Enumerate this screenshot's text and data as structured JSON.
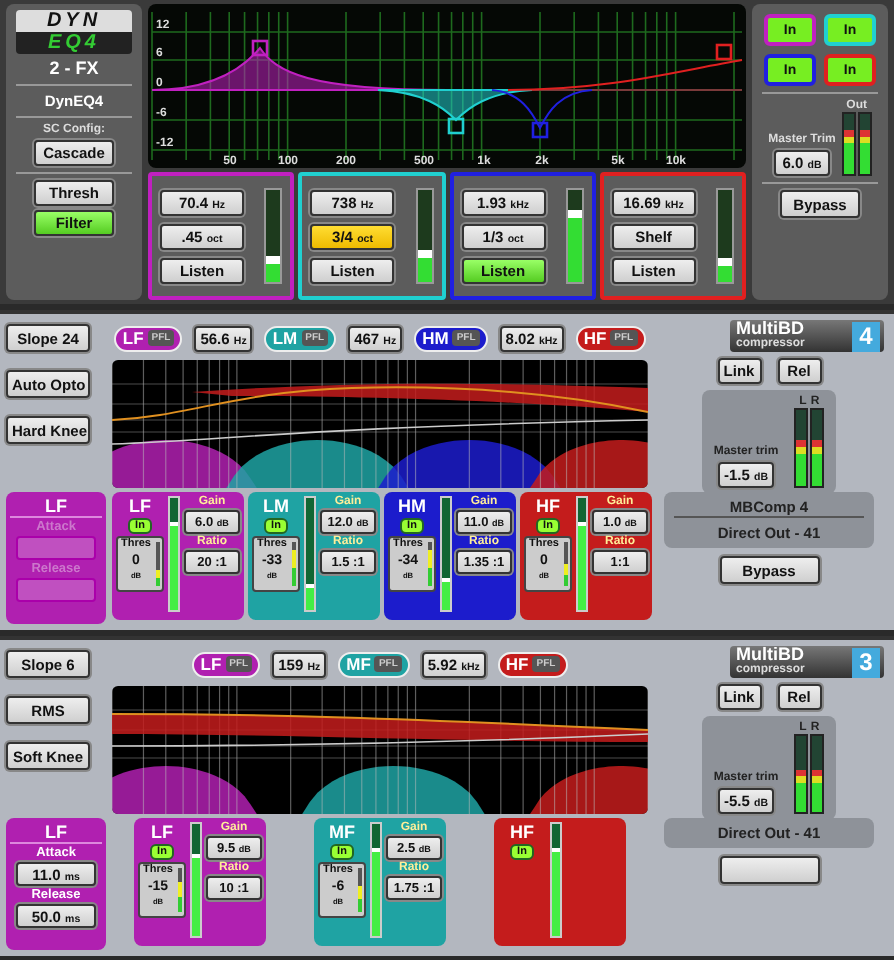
{
  "eq": {
    "logo": {
      "top": "DYN",
      "bottom": "EQ4"
    },
    "channel": "2 - FX",
    "name": "DynEQ4",
    "sc_label": "SC Config:",
    "sc_mode": "Cascade",
    "sc_buttons": [
      {
        "label": "Thresh",
        "on": false
      },
      {
        "label": "Filter",
        "on": true
      }
    ],
    "graph": {
      "y_labels": [
        "12",
        "6",
        "0",
        "-6",
        "-12"
      ],
      "x_labels": [
        "50",
        "100",
        "200",
        "500",
        "1k",
        "2k",
        "5k",
        "10k"
      ]
    },
    "bands": [
      {
        "color": "#c020c0",
        "freq": "70.4",
        "freq_unit": "Hz",
        "width": ".45",
        "width_unit": "oct",
        "width_active": false,
        "listen": "Listen",
        "listen_on": false,
        "level": 0.25
      },
      {
        "color": "#20d0d0",
        "freq": "738",
        "freq_unit": "Hz",
        "width": "3/4",
        "width_unit": "oct",
        "width_active": true,
        "listen": "Listen",
        "listen_on": false,
        "level": 0.3
      },
      {
        "color": "#2020e0",
        "freq": "1.93",
        "freq_unit": "kHz",
        "width": "1/3",
        "width_unit": "oct",
        "width_active": false,
        "listen": "Listen",
        "listen_on": true,
        "level": 0.75
      },
      {
        "color": "#e02020",
        "freq": "16.69",
        "freq_unit": "kHz",
        "width": "Shelf",
        "width_active": false,
        "listen": "Listen",
        "listen_on": false,
        "level": 0.22
      }
    ],
    "in_buttons": [
      {
        "label": "In",
        "on": true
      },
      {
        "label": "In",
        "on": true
      },
      {
        "label": "In",
        "on": true
      },
      {
        "label": "In",
        "on": true
      }
    ],
    "master_trim": {
      "label": "Master Trim",
      "value": "6.0",
      "unit": "dB"
    },
    "out": {
      "label": "Out",
      "meters": [
        {
          "level": 0.75
        },
        {
          "level": 0.75
        }
      ]
    },
    "bypass": {
      "label": "Bypass",
      "on": false
    }
  },
  "compressors": [
    {
      "left_buttons": [
        "Slope 24",
        "Auto Opto",
        "Hard Knee"
      ],
      "band_panel": {
        "title": "LF",
        "color": "#b020b0",
        "disabled": true,
        "params": [
          {
            "label": "Attack"
          },
          {
            "label": "Release"
          }
        ]
      },
      "tags": [
        {
          "kind": "band",
          "label": "LF",
          "pfl": "PFL",
          "color": "#b020b0"
        },
        {
          "kind": "freq",
          "value": "56.6",
          "unit": "Hz"
        },
        {
          "kind": "band",
          "label": "LM",
          "pfl": "PFL",
          "color": "#1fa3a3"
        },
        {
          "kind": "freq",
          "value": "467",
          "unit": "Hz"
        },
        {
          "kind": "band",
          "label": "HM",
          "pfl": "PFL",
          "color": "#1c1ccc"
        },
        {
          "kind": "freq",
          "value": "8.02",
          "unit": "kHz"
        },
        {
          "kind": "band",
          "label": "HF",
          "pfl": "PFL",
          "color": "#c41c1c"
        }
      ],
      "logo": {
        "name": "MultiBD",
        "sub": "compressor",
        "number": "4"
      },
      "link": "Link",
      "rel": "Rel",
      "master_trim": {
        "label": "Master trim",
        "value": "-1.5",
        "unit": "dB"
      },
      "meter": {
        "left": "L",
        "right": "R",
        "meters": [
          {
            "level": 0.6
          },
          {
            "level": 0.6
          }
        ]
      },
      "bands": [
        {
          "name": "LF",
          "color": "#b020b0",
          "in": "In",
          "in_on": true,
          "level": 0.75,
          "thres": {
            "label": "Thres",
            "value": "0",
            "unit": "dB",
            "level": 0.35
          },
          "gain": {
            "label": "Gain",
            "value": "6.0",
            "unit": "dB"
          },
          "ratio": {
            "label": "Ratio",
            "value": "20 :1"
          }
        },
        {
          "name": "LM",
          "color": "#1fa3a3",
          "in": "In",
          "in_on": true,
          "level": 0.2,
          "thres": {
            "label": "Thres",
            "value": "-33",
            "unit": "dB",
            "level": 0.8
          },
          "gain": {
            "label": "Gain",
            "value": "12.0",
            "unit": "dB"
          },
          "ratio": {
            "label": "Ratio",
            "value": "1.5 :1"
          }
        },
        {
          "name": "HM",
          "color": "#1c1ccc",
          "in": "In",
          "in_on": true,
          "level": 0.25,
          "thres": {
            "label": "Thres",
            "value": "-34",
            "unit": "dB",
            "level": 0.8
          },
          "gain": {
            "label": "Gain",
            "value": "11.0",
            "unit": "dB"
          },
          "ratio": {
            "label": "Ratio",
            "value": "1.35 :1"
          }
        },
        {
          "name": "HF",
          "color": "#c41c1c",
          "in": "In",
          "in_on": true,
          "level": 0.75,
          "thres": {
            "label": "Thres",
            "value": "0",
            "unit": "dB",
            "level": 0.5
          },
          "gain": {
            "label": "Gain",
            "value": "1.0",
            "unit": "dB"
          },
          "ratio": {
            "label": "Ratio",
            "value": "1:1"
          }
        }
      ],
      "output": {
        "name": "MBComp 4",
        "route": "Direct Out - 41"
      },
      "bypass": {
        "label": "Bypass",
        "on": false
      }
    },
    {
      "left_buttons": [
        "Slope 6",
        "RMS",
        "Soft Knee"
      ],
      "band_panel": {
        "title": "LF",
        "color": "#b020b0",
        "disabled": false,
        "params": [
          {
            "label": "Attack",
            "value": "11.0",
            "unit": "ms"
          },
          {
            "label": "Release",
            "value": "50.0",
            "unit": "ms"
          }
        ]
      },
      "tags": [
        {
          "kind": "band",
          "label": "LF",
          "pfl": "PFL",
          "color": "#b020b0"
        },
        {
          "kind": "freq",
          "value": "159",
          "unit": "Hz"
        },
        {
          "kind": "band",
          "label": "MF",
          "pfl": "PFL",
          "color": "#1fa3a3"
        },
        {
          "kind": "freq",
          "value": "5.92",
          "unit": "kHz"
        },
        {
          "kind": "band",
          "label": "HF",
          "pfl": "PFL",
          "color": "#c41c1c"
        }
      ],
      "logo": {
        "name": "MultiBD",
        "sub": "compressor",
        "number": "3"
      },
      "link": "Link",
      "rel": "Rel",
      "master_trim": {
        "label": "Master trim",
        "value": "-5.5",
        "unit": "dB"
      },
      "meter": {
        "left": "L",
        "right": "R",
        "meters": [
          {
            "level": 0.55
          },
          {
            "level": 0.55
          }
        ]
      },
      "bands": [
        {
          "name": "LF",
          "color": "#b020b0",
          "in": "In",
          "in_on": true,
          "level": 0.7,
          "thres": {
            "label": "Thres",
            "value": "-15",
            "unit": "dB",
            "level": 0.7
          },
          "gain": {
            "label": "Gain",
            "value": "9.5",
            "unit": "dB"
          },
          "ratio": {
            "label": "Ratio",
            "value": "10 :1"
          }
        },
        {
          "name": "MF",
          "color": "#1fa3a3",
          "in": "In",
          "in_on": true,
          "level": 0.75,
          "thres": {
            "label": "Thres",
            "value": "-6",
            "unit": "dB",
            "level": 0.6
          },
          "gain": {
            "label": "Gain",
            "value": "2.5",
            "unit": "dB"
          },
          "ratio": {
            "label": "Ratio",
            "value": "1.75 :1"
          }
        },
        {
          "name": "HF",
          "color": "#c41c1c",
          "in": "In",
          "in_on": true,
          "level": 0.75
        }
      ],
      "output": {
        "route": "Direct Out - 41"
      },
      "bypass": {
        "on": false
      }
    }
  ]
}
